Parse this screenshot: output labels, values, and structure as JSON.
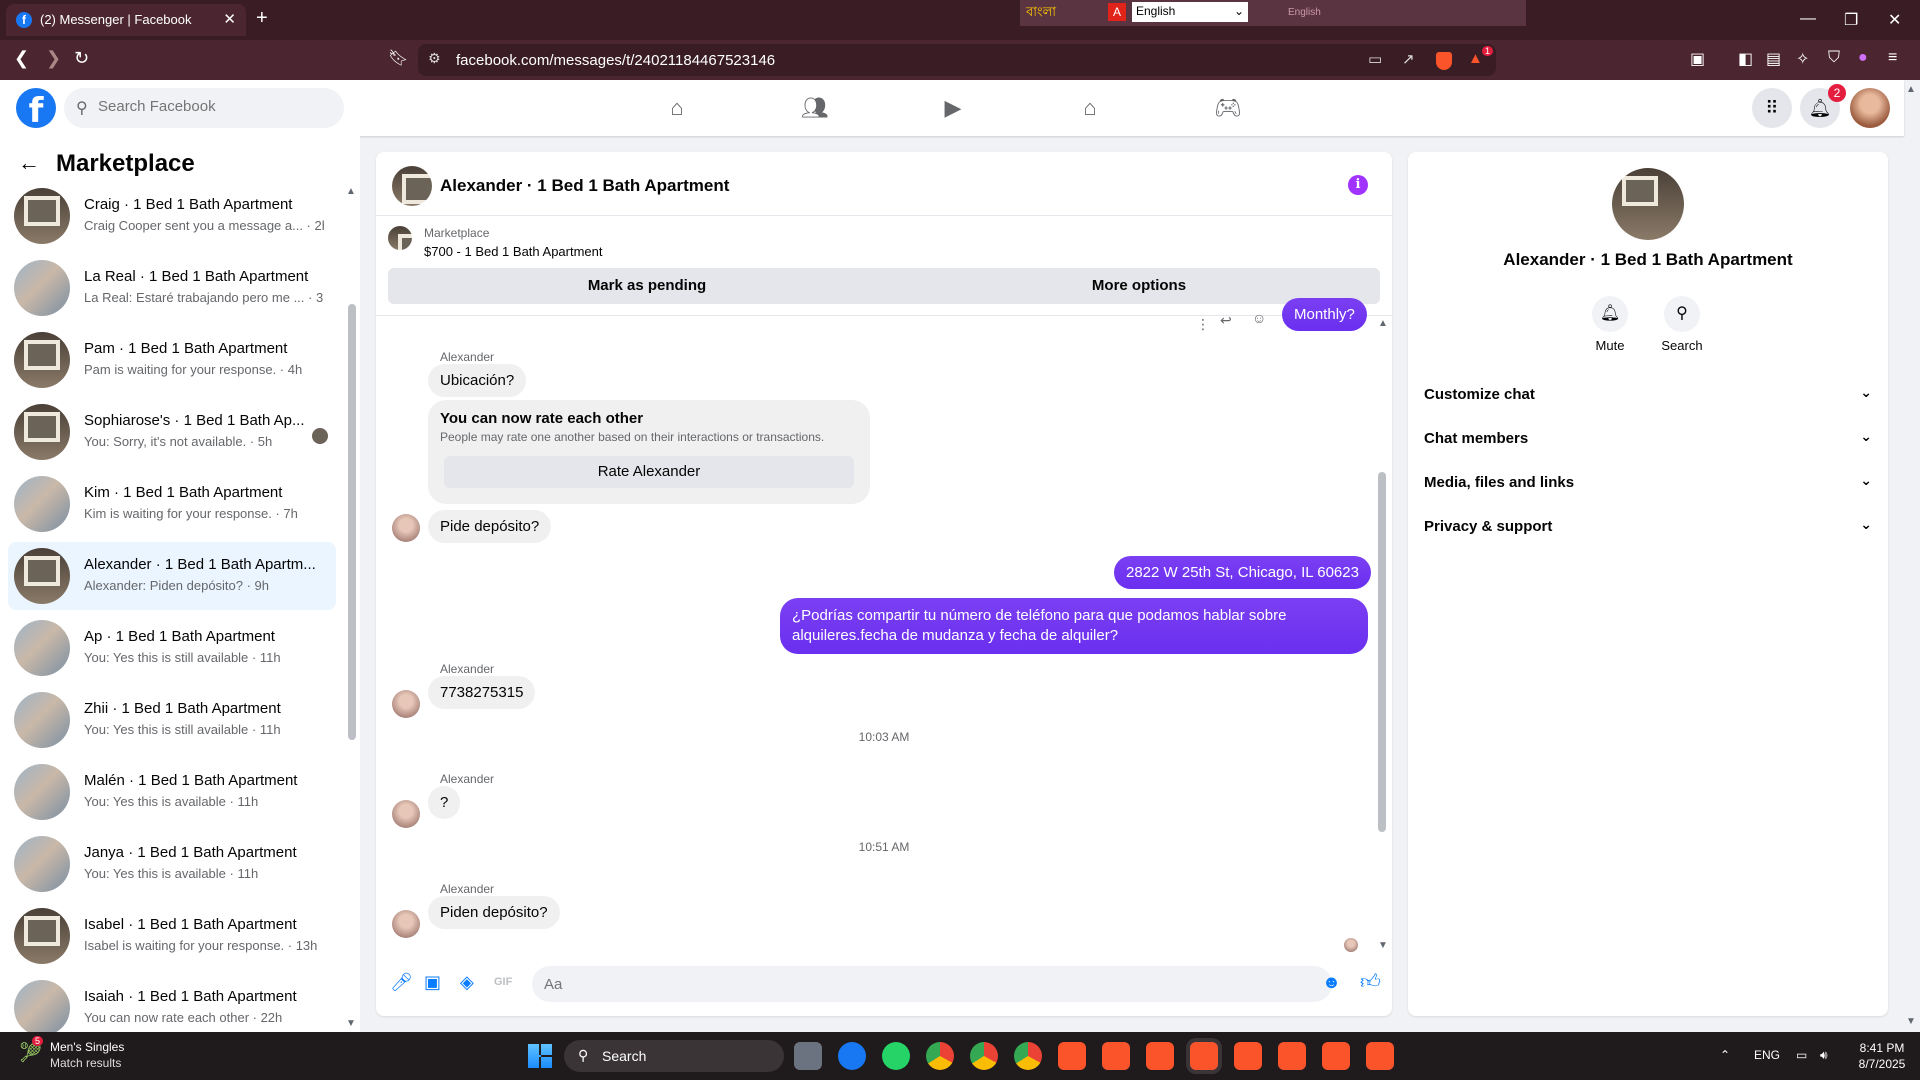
{
  "browser": {
    "tab_title": "(2) Messenger | Facebook",
    "tab_favicon": "f",
    "new_tab": "+",
    "url": "facebook.com/messages/t/24021184467523146",
    "lang_bengali": "বাংলা",
    "lang_select": "English",
    "lang_small": "English",
    "brave_badge": "1"
  },
  "fb": {
    "logo": "f",
    "search_placeholder": "Search Facebook",
    "notif_count": "2"
  },
  "left": {
    "title": "Marketplace",
    "conversations": [
      {
        "name": "Craig · 1 Bed 1 Bath Apartment",
        "preview": "Craig Cooper sent you a message a... · 2h",
        "avatar": "window"
      },
      {
        "name": "La Real · 1 Bed 1 Bath Apartment",
        "preview": "La Real: Estaré trabajando pero me ... · 3h",
        "avatar": "room"
      },
      {
        "name": "Pam · 1 Bed 1 Bath Apartment",
        "preview": "Pam is waiting for your response. · 4h",
        "avatar": "window"
      },
      {
        "name": "Sophiarose's · 1 Bed 1 Bath Ap...",
        "preview": "You: Sorry, it's not available. · 5h",
        "avatar": "window"
      },
      {
        "name": "Kim · 1 Bed 1 Bath Apartment",
        "preview": "Kim is waiting for your response. · 7h",
        "avatar": "room"
      },
      {
        "name": "Alexander · 1 Bed 1 Bath Apartm...",
        "preview": "Alexander: Piden depósito? · 9h",
        "avatar": "window"
      },
      {
        "name": "Ap · 1 Bed 1 Bath Apartment",
        "preview": "You: Yes this is still available · 11h",
        "avatar": "room"
      },
      {
        "name": "Zhii · 1 Bed 1 Bath Apartment",
        "preview": "You: Yes this is still available · 11h",
        "avatar": "room"
      },
      {
        "name": "Malén · 1 Bed 1 Bath Apartment",
        "preview": "You: Yes this is available · 11h",
        "avatar": "room"
      },
      {
        "name": "Janya · 1 Bed 1 Bath Apartment",
        "preview": "You: Yes this is available · 11h",
        "avatar": "room"
      },
      {
        "name": "Isabel · 1 Bed 1 Bath Apartment",
        "preview": "Isabel is waiting for your response. · 13h",
        "avatar": "window"
      },
      {
        "name": "Isaiah · 1 Bed 1 Bath Apartment",
        "preview": "You can now rate each other · 22h",
        "avatar": "room"
      }
    ]
  },
  "chat": {
    "title": "Alexander · 1 Bed 1 Bath Apartment",
    "marketplace_label": "Marketplace",
    "listing": "$700 - 1 Bed 1 Bath Apartment",
    "mark_pending": "Mark as pending",
    "more_options": "More options",
    "partial_bubble": "Monthly?",
    "sender": "Alexander",
    "msg_ubicacion": "Ubicación?",
    "rate_title": "You can now rate each other",
    "rate_sub": "People may rate one another based on their interactions or transactions.",
    "rate_button": "Rate Alexander",
    "msg_deposito1": "Pide depósito?",
    "msg_address": "2822 W 25th St, Chicago, IL  60623",
    "msg_phone_req": "¿Podrías compartir tu número de teléfono para que podamos hablar sobre alquileres.fecha de mudanza y fecha de alquiler?",
    "msg_phone": "7738275315",
    "time1": "10:03 AM",
    "msg_q": "?",
    "time2": "10:51 AM",
    "msg_deposito2": "Piden depósito?",
    "composer_placeholder": "Aa"
  },
  "right": {
    "name": "Alexander · 1 Bed 1 Bath Apartment",
    "mute": "Mute",
    "search": "Search",
    "sections": [
      "Customize chat",
      "Chat members",
      "Media, files and links",
      "Privacy & support"
    ]
  },
  "taskbar": {
    "widget_count": "5",
    "widget_title": "Men's Singles",
    "widget_sub": "Match results",
    "search": "Search",
    "lang": "ENG",
    "time": "8:41 PM",
    "date": "8/7/2025"
  },
  "colors": {
    "fb_blue": "#1877f2",
    "bubble_out": "#7b3ff2",
    "active_row": "#ebf5ff",
    "browser_frame": "#3a1c25"
  }
}
